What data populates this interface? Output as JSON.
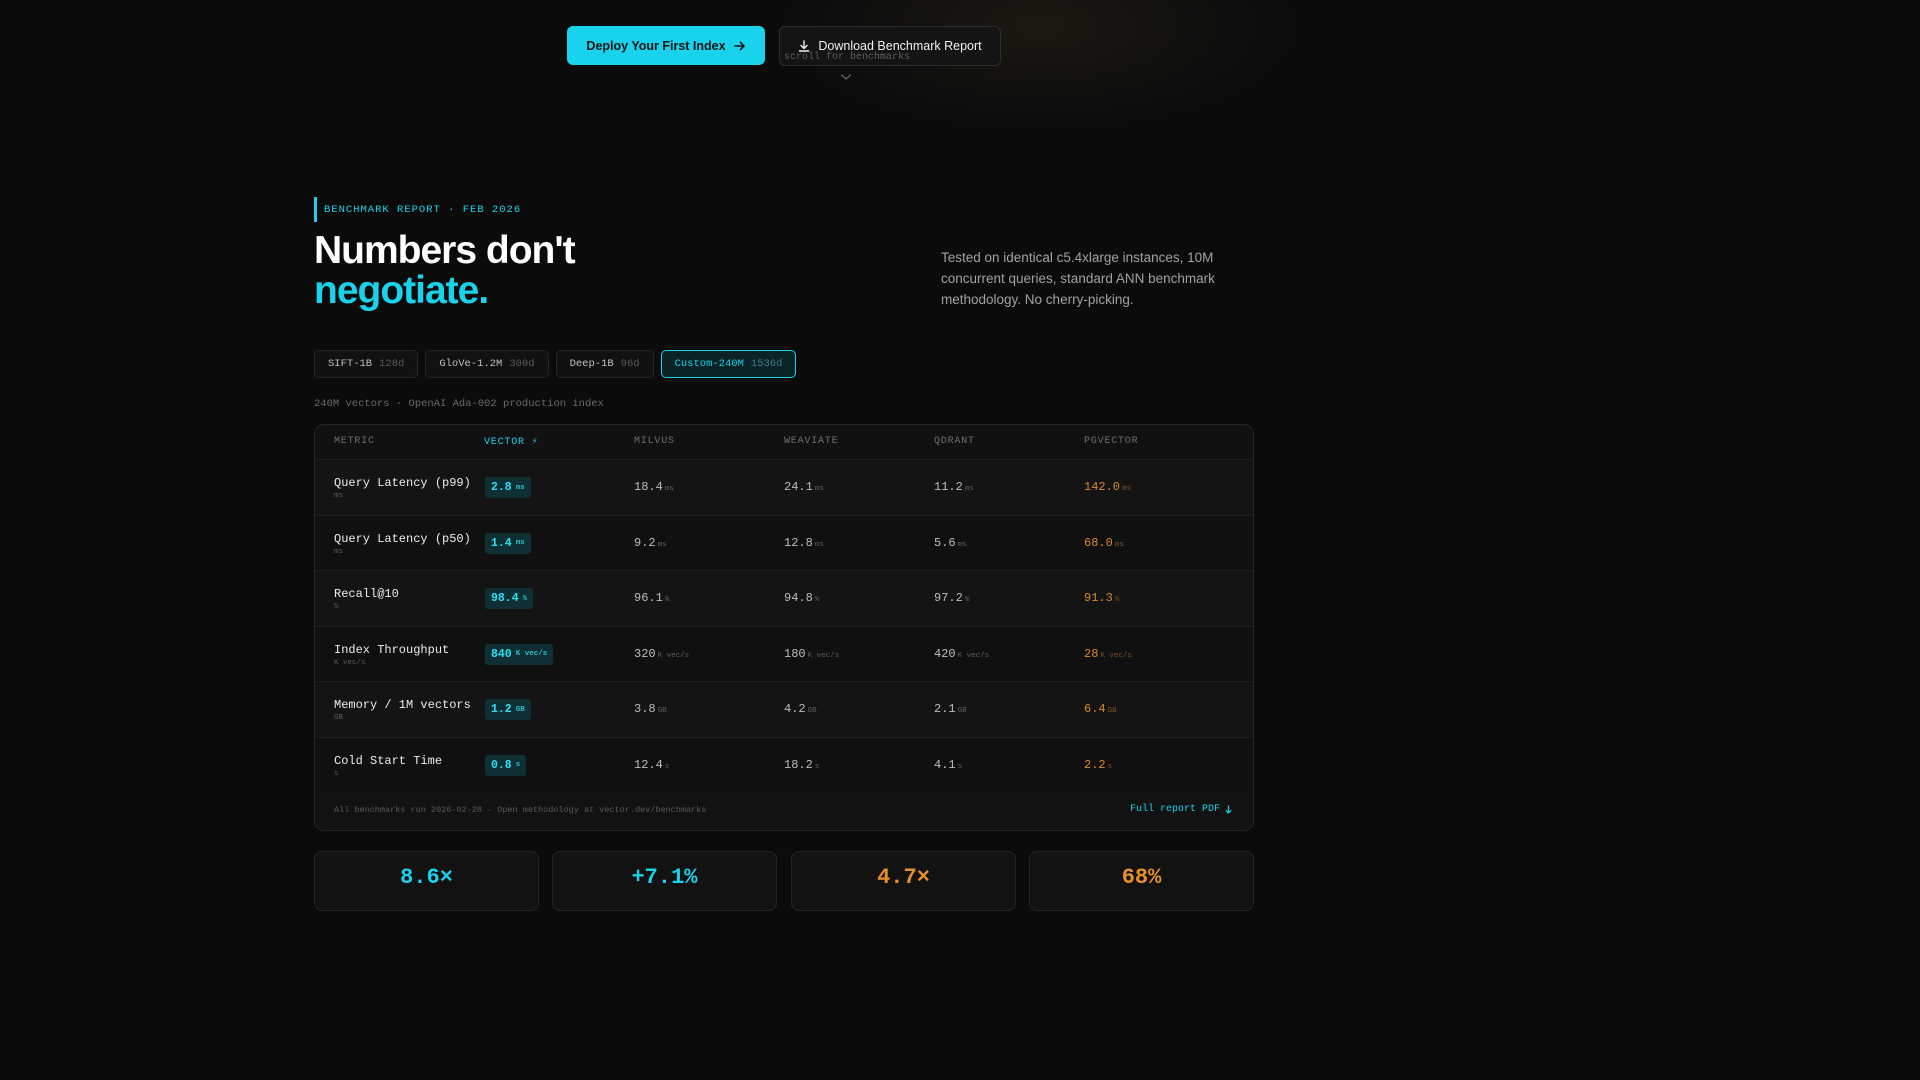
{
  "hero": {
    "primary_label": "Deploy Your First Index",
    "secondary_label": "Download Benchmark Report",
    "scroll_hint": "scroll for benchmarks"
  },
  "section": {
    "eyebrow": "BENCHMARK REPORT · FEB 2026",
    "title_line1": "Numbers don't",
    "title_line2": "negotiate.",
    "description": "Tested on identical c5.4xlarge instances, 10M concurrent queries, standard ANN benchmark methodology. No cherry-picking."
  },
  "datasets": [
    {
      "name": "SIFT-1B",
      "dims": "128d",
      "active": false
    },
    {
      "name": "GloVe-1.2M",
      "dims": "300d",
      "active": false
    },
    {
      "name": "Deep-1B",
      "dims": "96d",
      "active": false
    },
    {
      "name": "Custom-240M",
      "dims": "1536d",
      "active": true
    }
  ],
  "dataset_caption": "240M vectors · OpenAI Ada-002 production index",
  "table": {
    "headers": {
      "metric": "METRIC",
      "vector": "VECTOR ⚡",
      "milvus": "MILVUS",
      "weaviate": "WEAVIATE",
      "qdrant": "QDRANT",
      "pgvector": "PGVECTOR"
    },
    "rows": [
      {
        "metric": "Query Latency (p99)",
        "unit": "ms",
        "vector": "2.8",
        "milvus": "18.4",
        "weaviate": "24.1",
        "qdrant": "11.2",
        "pgvector": "142.0"
      },
      {
        "metric": "Query Latency (p50)",
        "unit": "ms",
        "vector": "1.4",
        "milvus": "9.2",
        "weaviate": "12.8",
        "qdrant": "5.6",
        "pgvector": "68.0"
      },
      {
        "metric": "Recall@10",
        "unit": "%",
        "vector": "98.4",
        "milvus": "96.1",
        "weaviate": "94.8",
        "qdrant": "97.2",
        "pgvector": "91.3"
      },
      {
        "metric": "Index Throughput",
        "unit": "K vec/s",
        "vector": "840",
        "milvus": "320",
        "weaviate": "180",
        "qdrant": "420",
        "pgvector": "28"
      },
      {
        "metric": "Memory / 1M vectors",
        "unit": "GB",
        "vector": "1.2",
        "milvus": "3.8",
        "weaviate": "4.2",
        "qdrant": "2.1",
        "pgvector": "6.4"
      },
      {
        "metric": "Cold Start Time",
        "unit": "s",
        "vector": "0.8",
        "milvus": "12.4",
        "weaviate": "18.2",
        "qdrant": "4.1",
        "pgvector": "2.2"
      }
    ],
    "footnote": "All benchmarks run 2026-02-28 · Open methodology at vector.dev/benchmarks",
    "full_report": "Full report PDF"
  },
  "stats": [
    {
      "value": "8.6×",
      "color": "#19d3ec"
    },
    {
      "value": "+7.1%",
      "color": "#19d3ec"
    },
    {
      "value": "4.7×",
      "color": "#e8902c"
    },
    {
      "value": "68%",
      "color": "#e8902c"
    }
  ],
  "colors": {
    "accent": "#19d3ec",
    "warning": "#d9892a",
    "background": "#0b0b0b"
  }
}
